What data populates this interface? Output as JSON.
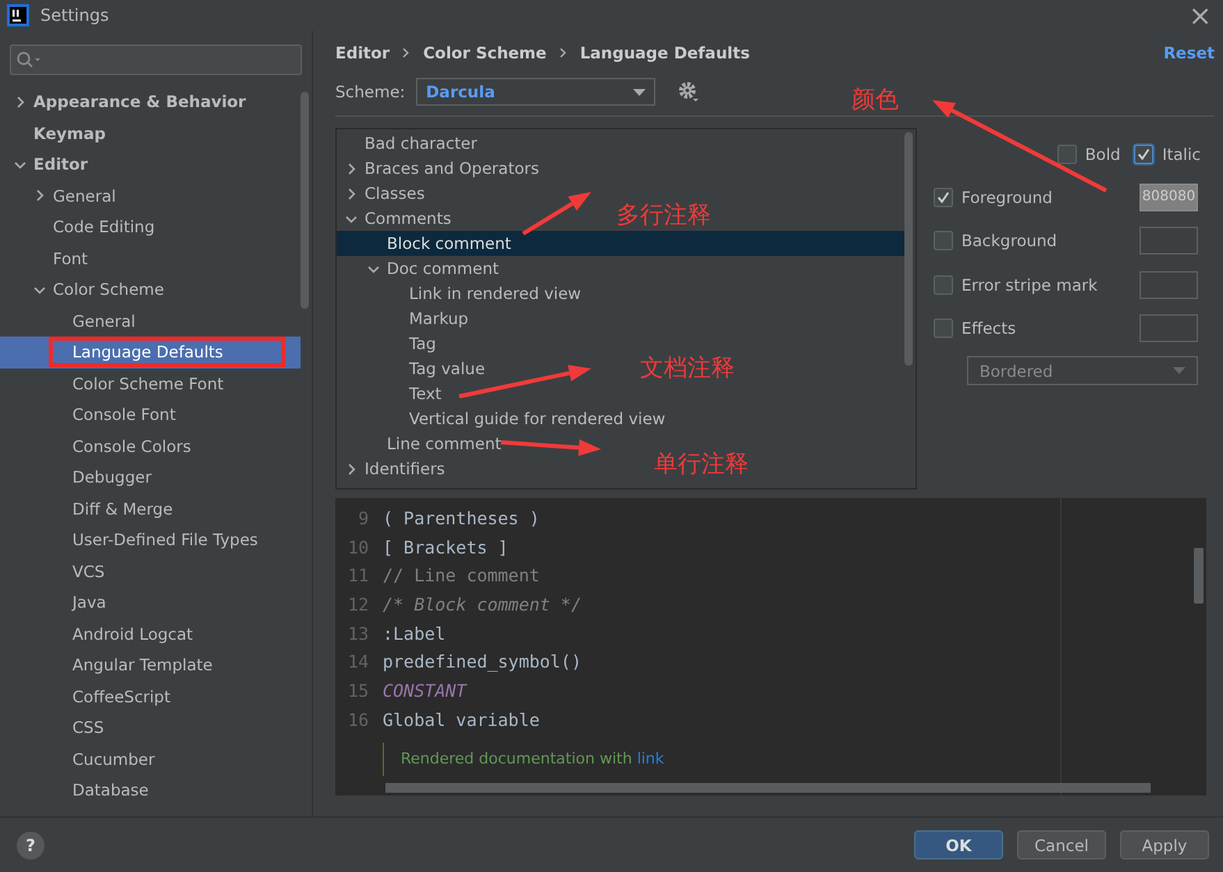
{
  "window": {
    "title": "Settings",
    "close": "×"
  },
  "sidebar": {
    "items": [
      {
        "label": "Appearance & Behavior",
        "expanded": false,
        "selected": false
      },
      {
        "label": "Keymap",
        "selected": false
      },
      {
        "label": "Editor",
        "expanded": true,
        "selected": false,
        "children": [
          {
            "label": "General",
            "expanded": false,
            "selected": false
          },
          {
            "label": "Code Editing",
            "selected": false
          },
          {
            "label": "Font",
            "selected": false
          },
          {
            "label": "Color Scheme",
            "expanded": true,
            "selected": false,
            "children": [
              {
                "label": "General",
                "selected": false
              },
              {
                "label": "Language Defaults",
                "selected": true,
                "highlighted": true
              },
              {
                "label": "Color Scheme Font",
                "selected": false
              },
              {
                "label": "Console Font",
                "selected": false
              },
              {
                "label": "Console Colors",
                "selected": false
              },
              {
                "label": "Debugger",
                "selected": false
              },
              {
                "label": "Diff & Merge",
                "selected": false
              },
              {
                "label": "User-Defined File Types",
                "selected": false
              },
              {
                "label": "VCS",
                "selected": false
              },
              {
                "label": "Java",
                "selected": false
              },
              {
                "label": "Android Logcat",
                "selected": false
              },
              {
                "label": "Angular Template",
                "selected": false
              },
              {
                "label": "CoffeeScript",
                "selected": false
              },
              {
                "label": "CSS",
                "selected": false
              },
              {
                "label": "Cucumber",
                "selected": false
              },
              {
                "label": "Database",
                "selected": false
              }
            ]
          }
        ]
      }
    ]
  },
  "breadcrumb": [
    "Editor",
    "Color Scheme",
    "Language Defaults"
  ],
  "reset": "Reset",
  "scheme": {
    "label": "Scheme:",
    "value": "Darcula"
  },
  "attributes": {
    "items": [
      {
        "label": "Bad character",
        "selected": false
      },
      {
        "label": "Braces and Operators",
        "expanded": false,
        "selected": false
      },
      {
        "label": "Classes",
        "expanded": false,
        "selected": false
      },
      {
        "label": "Comments",
        "expanded": true,
        "selected": false,
        "children": [
          {
            "label": "Block comment",
            "selected": true
          },
          {
            "label": "Doc comment",
            "expanded": true,
            "selected": false,
            "children": [
              {
                "label": "Link in rendered view",
                "selected": false
              },
              {
                "label": "Markup",
                "selected": false
              },
              {
                "label": "Tag",
                "selected": false
              },
              {
                "label": "Tag value",
                "selected": false
              },
              {
                "label": "Text",
                "selected": false
              },
              {
                "label": "Vertical guide for rendered view",
                "selected": false
              }
            ]
          },
          {
            "label": "Line comment",
            "selected": false
          }
        ]
      },
      {
        "label": "Identifiers",
        "expanded": false,
        "selected": false
      }
    ]
  },
  "options": {
    "bold": {
      "label": "Bold",
      "checked": false
    },
    "italic": {
      "label": "Italic",
      "checked": true
    },
    "colors": [
      {
        "label": "Foreground",
        "checked": true,
        "value": "808080"
      },
      {
        "label": "Background",
        "checked": false
      },
      {
        "label": "Error stripe mark",
        "checked": false
      },
      {
        "label": "Effects",
        "checked": false
      }
    ],
    "effect_type": {
      "value": "Bordered",
      "disabled": true
    }
  },
  "preview": {
    "lines": [
      {
        "number": "9",
        "text": "( Parentheses )",
        "kind": "plain"
      },
      {
        "number": "10",
        "text": "[ Brackets ]",
        "kind": "plain"
      },
      {
        "number": "11",
        "text": "// Line comment",
        "kind": "line_comment"
      },
      {
        "number": "12",
        "text": "/* Block comment */",
        "kind": "block_comment"
      },
      {
        "number": "13",
        "text": ":Label",
        "kind": "plain"
      },
      {
        "number": "14",
        "text": "predefined_symbol()",
        "kind": "plain"
      },
      {
        "number": "15",
        "text": "CONSTANT",
        "kind": "constant"
      },
      {
        "number": "16",
        "text": "Global variable",
        "kind": "plain"
      }
    ],
    "doc": {
      "text": "Rendered documentation with",
      "link": "link"
    }
  },
  "annotations": [
    {
      "kind": "arrow"
    },
    {
      "kind": "arrow"
    },
    {
      "kind": "arrow"
    },
    {
      "kind": "arrow"
    },
    {
      "kind": "label",
      "text": "颜色"
    },
    {
      "kind": "label",
      "text": "多行注释"
    },
    {
      "kind": "label",
      "text": "文档注释"
    },
    {
      "kind": "label",
      "text": "单行注释"
    }
  ],
  "footer": {
    "help": "?",
    "buttons": [
      {
        "label": "OK",
        "primary": true
      },
      {
        "label": "Cancel",
        "primary": false
      },
      {
        "label": "Apply",
        "primary": false
      }
    ]
  }
}
